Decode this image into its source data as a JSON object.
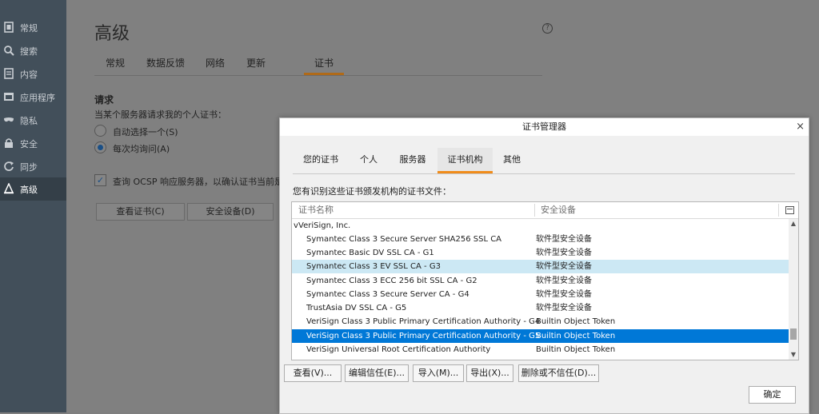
{
  "sidebar": {
    "items": [
      {
        "label": "常规",
        "icon": "general-icon"
      },
      {
        "label": "搜索",
        "icon": "search-icon"
      },
      {
        "label": "内容",
        "icon": "content-icon"
      },
      {
        "label": "应用程序",
        "icon": "applications-icon"
      },
      {
        "label": "隐私",
        "icon": "privacy-mask-icon"
      },
      {
        "label": "安全",
        "icon": "security-lock-icon"
      },
      {
        "label": "同步",
        "icon": "sync-icon"
      },
      {
        "label": "高级",
        "icon": "advanced-wizard-hat-icon",
        "active": true
      }
    ]
  },
  "page": {
    "title": "高级",
    "help_icon_text": "?",
    "tabs": [
      "常规",
      "数据反馈",
      "网络",
      "更新",
      "证书"
    ],
    "selected_tab": "证书",
    "section_title": "请求",
    "section_subtitle": "当某个服务器请求我的个人证书：",
    "radio_options": [
      {
        "label": "自动选择一个(S)",
        "checked": false
      },
      {
        "label": "每次均询问(A)",
        "checked": true
      }
    ],
    "ocsp_label": "查询 OCSP 响应服务器，以确认证书当前是",
    "ocsp_checked": true,
    "buttons": {
      "view_certs": "查看证书(C)",
      "security_devices": "安全设备(D)"
    }
  },
  "dialog": {
    "title": "证书管理器",
    "close_glyph": "×",
    "tabs": [
      "您的证书",
      "个人",
      "服务器",
      "证书机构",
      "其他"
    ],
    "selected_tab": "证书机构",
    "description": "您有识别这些证书颁发机构的证书文件：",
    "columns": {
      "name": "证书名称",
      "device": "安全设备"
    },
    "group": "VeriSign, Inc.",
    "group_expander": "v",
    "rows": [
      {
        "name": "Symantec Class 3 Secure Server SHA256 SSL CA",
        "device": "软件型安全设备"
      },
      {
        "name": "Symantec Basic DV SSL CA - G1",
        "device": "软件型安全设备"
      },
      {
        "name": "Symantec Class 3 EV SSL CA - G3",
        "device": "软件型安全设备",
        "state": "hover"
      },
      {
        "name": "Symantec Class 3 ECC 256 bit SSL CA - G2",
        "device": "软件型安全设备"
      },
      {
        "name": "Symantec Class 3 Secure Server CA - G4",
        "device": "软件型安全设备"
      },
      {
        "name": "TrustAsia DV SSL CA - G5",
        "device": "软件型安全设备"
      },
      {
        "name": "VeriSign Class 3 Public Primary Certification Authority - G4",
        "device": "Builtin Object Token"
      },
      {
        "name": "VeriSign Class 3 Public Primary Certification Authority - G5",
        "device": "Builtin Object Token",
        "state": "selected"
      },
      {
        "name": "VeriSign Universal Root Certification Authority",
        "device": "Builtin Object Token"
      }
    ],
    "buttons": {
      "view": "查看(V)...",
      "edit_trust": "编辑信任(E)...",
      "import": "导入(M)...",
      "export": "导出(X)...",
      "delete": "删除或不信任(D)...",
      "ok": "确定"
    },
    "colors": {
      "accent_tab": "#f08c1a",
      "selected_row": "#0078d7",
      "hover_row": "#cce8f4"
    }
  }
}
